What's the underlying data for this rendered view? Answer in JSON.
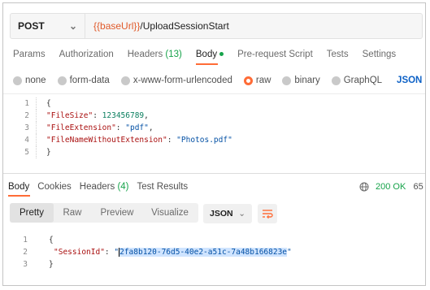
{
  "request": {
    "method": "POST",
    "url_variable": "{{baseUrl}}",
    "url_path": "/UploadSessionStart"
  },
  "request_tabs": [
    {
      "label": "Params"
    },
    {
      "label": "Authorization"
    },
    {
      "label": "Headers",
      "count": "(13)"
    },
    {
      "label": "Body",
      "active": true
    },
    {
      "label": "Pre-request Script"
    },
    {
      "label": "Tests"
    },
    {
      "label": "Settings"
    }
  ],
  "body_options": [
    {
      "label": "none",
      "selected": false
    },
    {
      "label": "form-data",
      "selected": false
    },
    {
      "label": "x-www-form-urlencoded",
      "selected": false
    },
    {
      "label": "raw",
      "selected": true
    },
    {
      "label": "binary",
      "selected": false
    },
    {
      "label": "GraphQL",
      "selected": false
    }
  ],
  "body_format": "JSON",
  "request_body": {
    "line_numbers": [
      "1",
      "2",
      "3",
      "4",
      "5"
    ],
    "open_brace": "{",
    "close_brace": "}",
    "fields": [
      {
        "key": "\"FileSize\"",
        "value": "123456789",
        "type": "number"
      },
      {
        "key": "\"FileExtension\"",
        "value": "\"pdf\"",
        "type": "string"
      },
      {
        "key": "\"FileNameWithoutExtension\"",
        "value": "\"Photos.pdf\"",
        "type": "string"
      }
    ]
  },
  "response_tabs": [
    {
      "label": "Body",
      "active": true
    },
    {
      "label": "Cookies"
    },
    {
      "label": "Headers",
      "count": "(4)"
    },
    {
      "label": "Test Results"
    }
  ],
  "response_status": {
    "code": "200 OK",
    "extra": "65"
  },
  "view_modes": [
    {
      "label": "Pretty",
      "active": true
    },
    {
      "label": "Raw"
    },
    {
      "label": "Preview"
    },
    {
      "label": "Visualize"
    }
  ],
  "response_format": "JSON",
  "response_body": {
    "line_numbers": [
      "1",
      "2",
      "3"
    ],
    "open_brace": "{",
    "close_brace": "}",
    "key": "\"SessionId\"",
    "value_quote_open": "\"",
    "value_selected": "2fa8b120-76d5-40e2-a51c-7a48b166823e",
    "value_quote_close": "\""
  },
  "colors": {
    "accent": "#ff6c37",
    "success": "#16a34a",
    "link": "#0d61c6",
    "variable": "#e05a2a"
  }
}
